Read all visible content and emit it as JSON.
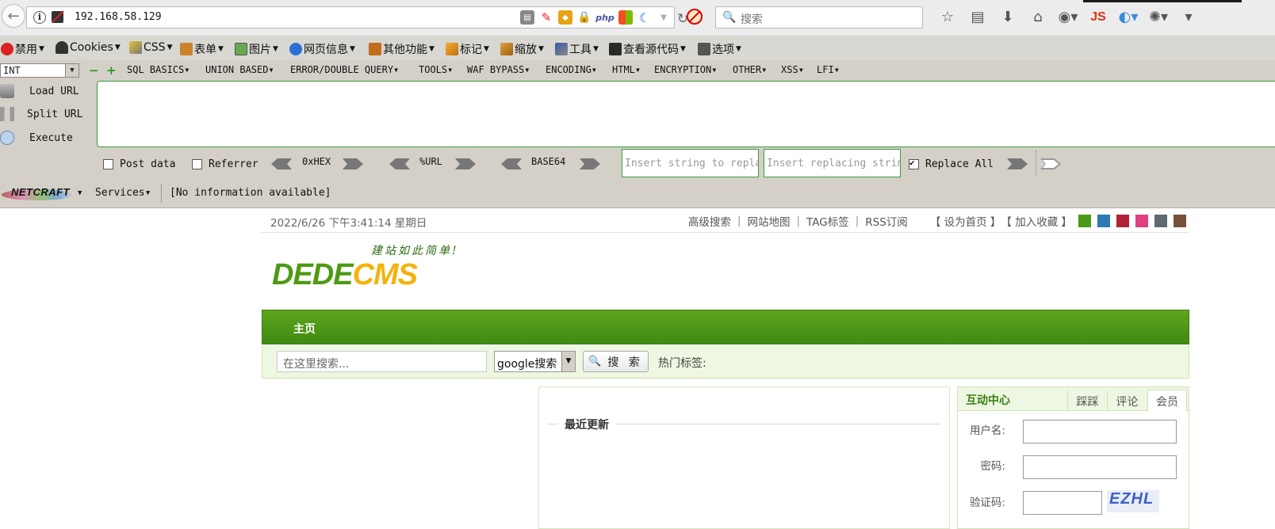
{
  "browser": {
    "url": "192.168.58.129",
    "search_placeholder": "搜索",
    "toolbar_js_label": "JS"
  },
  "devtoolbar": {
    "items": [
      {
        "label": "禁用",
        "icon": "disable-icon"
      },
      {
        "label": "Cookies",
        "icon": "cookie-icon"
      },
      {
        "label": "CSS",
        "icon": "css-icon"
      },
      {
        "label": "表单",
        "icon": "form-icon"
      },
      {
        "label": "图片",
        "icon": "image-icon"
      },
      {
        "label": "网页信息",
        "icon": "info-icon"
      },
      {
        "label": "其他功能",
        "icon": "misc-icon"
      },
      {
        "label": "标记",
        "icon": "outline-icon"
      },
      {
        "label": "缩放",
        "icon": "resize-icon"
      },
      {
        "label": "工具",
        "icon": "tools-icon"
      },
      {
        "label": "查看源代码",
        "icon": "source-icon"
      },
      {
        "label": "选项",
        "icon": "options-icon"
      }
    ]
  },
  "hackbar": {
    "select_value": "INT",
    "menus": [
      "SQL BASICS",
      "UNION BASED",
      "ERROR/DOUBLE QUERY",
      "TOOLS",
      "WAF BYPASS",
      "ENCODING",
      "HTML",
      "ENCRYPTION",
      "OTHER",
      "XSS",
      "LFI"
    ],
    "load_url": "Load URL",
    "split_url": "Split URL",
    "execute": "Execute",
    "post_data": "Post data",
    "referrer": "Referrer",
    "hex_label": "0xHEX",
    "url_label": "%URL",
    "base64_label": "BASE64",
    "replace_from_placeholder": "Insert string to replace",
    "replace_to_placeholder": "Insert replacing string",
    "replace_all": "Replace All",
    "replace_all_checked": true
  },
  "netcraft": {
    "logo_text": "NETCRAFT",
    "services": "Services",
    "info": "[No information available]"
  },
  "site": {
    "datetime": "2022/6/26 下午3:41:14 星期日",
    "toplinks": [
      "高级搜索",
      "网站地图",
      "TAG标签",
      "RSS订阅"
    ],
    "set_home": "【 设为首页 】",
    "add_fav": "【 加入收藏 】",
    "swatch_colors": [
      "#4c9a16",
      "#2a7ab4",
      "#b2213a",
      "#e0417f",
      "#5e6a70",
      "#7a4f3a"
    ],
    "logo_slogan": "建站如此简单!",
    "logo_part1": "DEDE",
    "logo_part2": "CMS",
    "nav_home": "主页",
    "search_placeholder": "在这里搜索...",
    "search_engine": "google搜索",
    "search_button": "搜 索",
    "hot_tags": "热门标签:",
    "recent_updates": "最近更新",
    "interact_title": "互动中心",
    "tabs": [
      "踩踩",
      "评论",
      "会员"
    ],
    "username_label": "用户名:",
    "password_label": "密码:",
    "captcha_label": "验证码:",
    "captcha_text": "EZHL"
  }
}
